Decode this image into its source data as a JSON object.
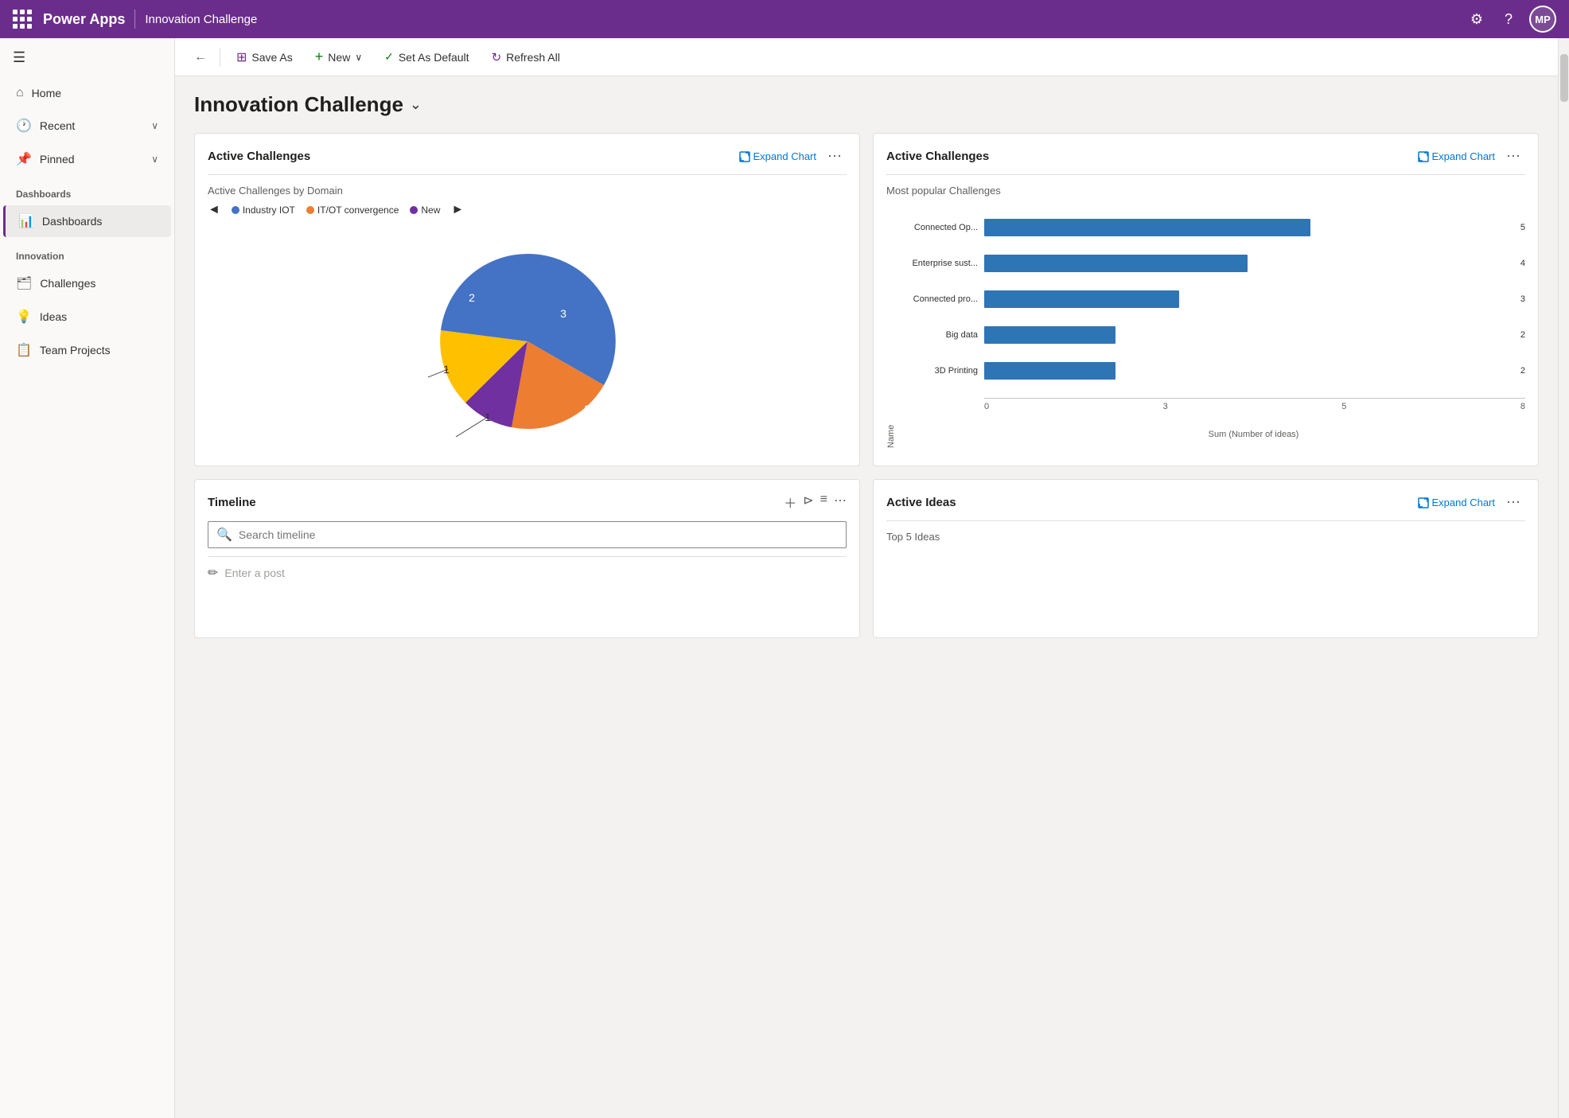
{
  "topbar": {
    "app_name": "Power Apps",
    "page_title": "Innovation Challenge",
    "avatar_initials": "MP"
  },
  "toolbar": {
    "back_label": "←",
    "save_as_label": "Save As",
    "new_label": "New",
    "set_default_label": "Set As Default",
    "refresh_label": "Refresh All"
  },
  "page_header": {
    "title": "Innovation Challenge",
    "chevron": "⌄"
  },
  "sidebar": {
    "nav_items": [
      {
        "id": "home",
        "label": "Home",
        "icon": "⌂",
        "has_chevron": false
      },
      {
        "id": "recent",
        "label": "Recent",
        "icon": "🕐",
        "has_chevron": true
      },
      {
        "id": "pinned",
        "label": "Pinned",
        "icon": "📌",
        "has_chevron": true
      }
    ],
    "sections": [
      {
        "title": "Dashboards",
        "items": [
          {
            "id": "dashboards",
            "label": "Dashboards",
            "icon": "📊",
            "active": true
          }
        ]
      },
      {
        "title": "Innovation",
        "items": [
          {
            "id": "challenges",
            "label": "Challenges",
            "icon": "🗂"
          },
          {
            "id": "ideas",
            "label": "Ideas",
            "icon": "💡"
          },
          {
            "id": "team-projects",
            "label": "Team Projects",
            "icon": "📋"
          }
        ]
      }
    ]
  },
  "chart1": {
    "title": "Active Challenges",
    "expand_label": "Expand Chart",
    "subtitle": "Active Challenges by Domain",
    "legend": [
      {
        "label": "Industry IOT",
        "color": "#4472c4"
      },
      {
        "label": "IT/OT convergence",
        "color": "#ed7d31"
      },
      {
        "label": "New",
        "color": "#7030a0"
      }
    ],
    "slices": [
      {
        "label": "3",
        "value": 3,
        "color": "#4472c4",
        "startAngle": 0,
        "endAngle": 140
      },
      {
        "label": "2",
        "value": 2,
        "color": "#ed7d31",
        "startAngle": 140,
        "endAngle": 235
      },
      {
        "label": "1",
        "value": 1,
        "color": "#7030a0",
        "startAngle": 235,
        "endAngle": 275
      },
      {
        "label": "1",
        "value": 1,
        "color": "#ffc000",
        "startAngle": 275,
        "endAngle": 320
      },
      {
        "label": "2",
        "value": 2,
        "color": "#4472c4",
        "startAngle": 320,
        "endAngle": 360
      }
    ]
  },
  "chart2": {
    "title": "Active Challenges",
    "expand_label": "Expand Chart",
    "subtitle": "Most popular Challenges",
    "y_axis_label": "Name",
    "x_axis_label": "Sum (Number of ideas)",
    "x_ticks": [
      "0",
      "3",
      "5",
      "8"
    ],
    "bars": [
      {
        "label": "Connected Op...",
        "value": 5,
        "percent": 62
      },
      {
        "label": "Enterprise sust...",
        "value": 4,
        "percent": 50
      },
      {
        "label": "Connected pro...",
        "value": 3,
        "percent": 37
      },
      {
        "label": "Big data",
        "value": 2,
        "percent": 25
      },
      {
        "label": "3D Printing",
        "value": 2,
        "percent": 25
      }
    ]
  },
  "timeline": {
    "title": "Timeline",
    "search_placeholder": "Search timeline",
    "post_placeholder": "Enter a post"
  },
  "chart3": {
    "title": "Active Ideas",
    "expand_label": "Expand Chart",
    "subtitle": "Top 5 Ideas"
  }
}
